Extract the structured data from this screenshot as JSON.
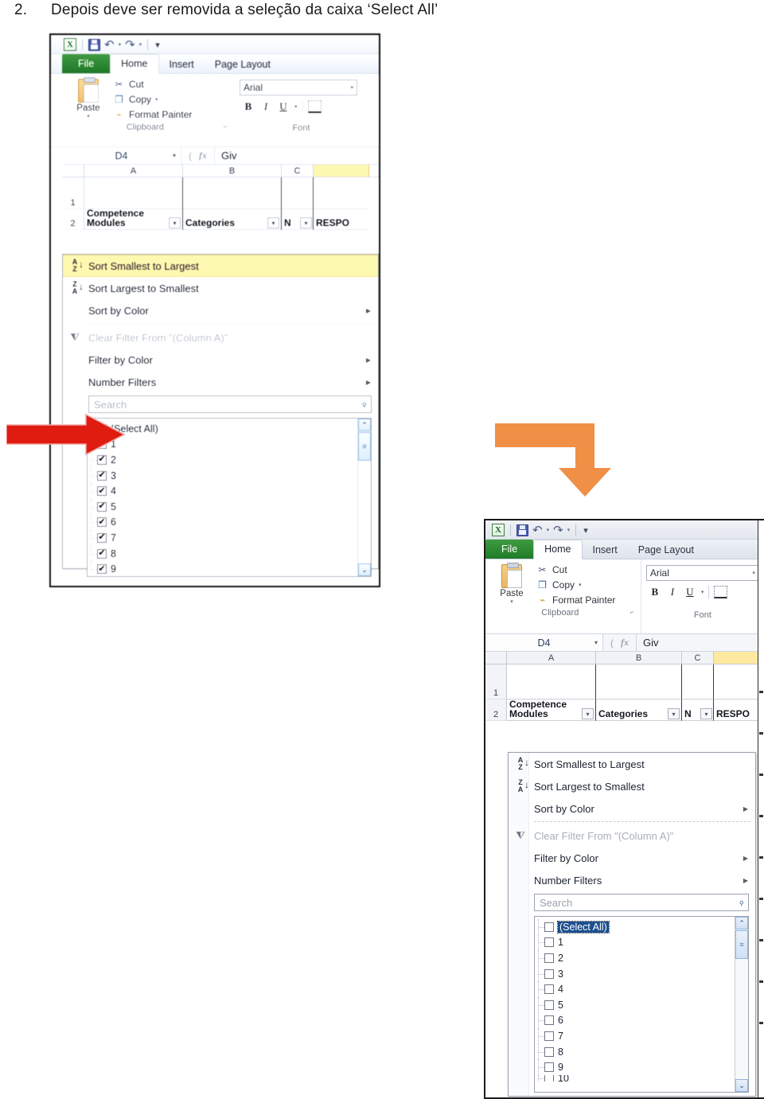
{
  "heading": {
    "number": "2.",
    "text": "Depois deve ser removida a seleção da caixa ‘Select All’"
  },
  "colors": {
    "red_arrow": "#e01b10",
    "orange_arrow": "#ef9046",
    "file_tab_green": "#2d8a30",
    "highlight_yellow": "#ffeaa0",
    "selection_blue": "#1d4f91"
  },
  "excel": {
    "quick_access": {
      "logo": "X",
      "save_icon": "save-icon",
      "undo_icon": "↶",
      "redo_icon": "↷",
      "customize_icon": "▾"
    },
    "tabs": [
      {
        "label": "File",
        "state": "file"
      },
      {
        "label": "Home",
        "state": "active"
      },
      {
        "label": "Insert",
        "state": "normal"
      },
      {
        "label": "Page Layout",
        "state": "normal"
      }
    ],
    "clipboard_group": {
      "label": "Clipboard",
      "dialog_launcher": "⌐",
      "paste_label": "Paste",
      "paste_caret": "▾",
      "items": [
        {
          "label": "Cut",
          "icon": "scissors-icon",
          "glyph": "✂"
        },
        {
          "label": "Copy",
          "icon": "copy-icon",
          "glyph": "❐",
          "caret": "▾"
        },
        {
          "label": "Format Painter",
          "icon": "paintbrush-icon",
          "glyph": "🖌"
        }
      ]
    },
    "font_group": {
      "label": "Font",
      "font_name": "Arial",
      "font_caret": "▾",
      "bold": "B",
      "italic": "I",
      "underline": "U",
      "underline_caret": "▾",
      "borders_icon": "borders-icon"
    },
    "formula_bar": {
      "name_box": "D4",
      "name_box_caret": "▾",
      "cancel": "✕",
      "enter": "✓",
      "fx": "fx",
      "content": "Giv"
    },
    "sheet": {
      "column_headers": [
        "A",
        "B",
        "C",
        ""
      ],
      "row_headers": [
        "1",
        "2"
      ],
      "cells": [
        {
          "text": "Competence\nModules",
          "filter": true
        },
        {
          "text": "Categories",
          "filter": true
        },
        {
          "text": "N",
          "filter": true
        },
        {
          "text": "RESPO",
          "filter": false
        }
      ]
    },
    "filter_menu": {
      "items": [
        {
          "label": "Sort Smallest to Largest",
          "icon": "sort-ascending-icon",
          "icon_text": "A\nZ",
          "arrow": "↓",
          "submenu": false,
          "disabled": false
        },
        {
          "label": "Sort Largest to Smallest",
          "icon": "sort-descending-icon",
          "icon_text": "Z\nA",
          "arrow": "↓",
          "submenu": false,
          "disabled": false
        },
        {
          "label": "Sort by Color",
          "icon": "",
          "submenu": true,
          "disabled": false
        },
        {
          "label": "Clear Filter From \"(Column A)\"",
          "icon": "clear-filter-icon",
          "submenu": false,
          "disabled": true
        },
        {
          "label": "Filter by Color",
          "icon": "",
          "submenu": true,
          "disabled": false
        },
        {
          "label": "Number Filters",
          "icon": "",
          "submenu": true,
          "disabled": false
        }
      ],
      "submenu_arrow": "▶",
      "search_placeholder": "Search",
      "search_icon": "magnifier-icon",
      "checklist": [
        "(Select All)",
        "1",
        "2",
        "3",
        "4",
        "5",
        "6",
        "7",
        "8",
        "9",
        "10"
      ],
      "scroll_up_icon": "chevron-up-icon",
      "scroll_down_icon": "chevron-down-icon",
      "scroll_thumb_icon": "scrollbar-thumb"
    }
  },
  "screenshot_before": {
    "caption": "before-state",
    "highlighted_menu_item": "Sort Smallest to Largest",
    "all_checked": true,
    "select_all_selected": false
  },
  "screenshot_after": {
    "caption": "after-state",
    "highlighted_menu_item": "",
    "all_checked": false,
    "select_all_selected": true
  },
  "annotations": {
    "red_arrow": {
      "name": "red-arrow-pointing-to-select-all",
      "direction": "right"
    },
    "orange_arrow": {
      "name": "orange-elbow-arrow",
      "direction": "down"
    }
  }
}
